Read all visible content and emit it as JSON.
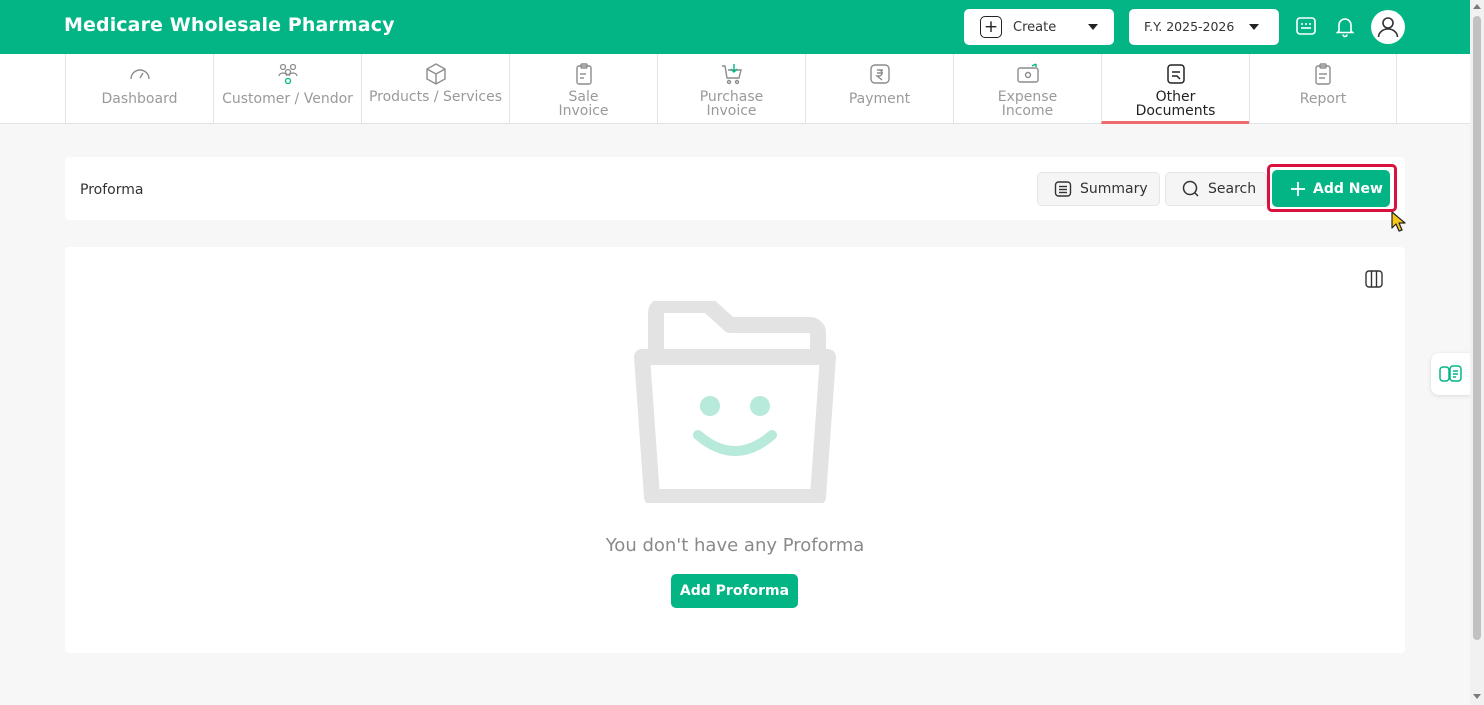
{
  "header": {
    "app_title": "Medicare Wholesale Pharmacy",
    "create_label": "Create",
    "fy_label": "F.Y. 2025-2026",
    "brand_color": "#03b585"
  },
  "nav": {
    "items": [
      {
        "label": "Dashboard",
        "icon": "gauge-icon"
      },
      {
        "label": "Customer / Vendor",
        "icon": "users-icon"
      },
      {
        "label": "Products / Services",
        "icon": "box-icon"
      },
      {
        "label": "Sale\nInvoice",
        "icon": "clipboard-icon"
      },
      {
        "label": "Purchase\nInvoice",
        "icon": "cart-icon"
      },
      {
        "label": "Payment",
        "icon": "rupee-icon"
      },
      {
        "label": "Expense\nIncome",
        "icon": "money-icon"
      },
      {
        "label": "Other\nDocuments",
        "icon": "document-icon",
        "active": true
      },
      {
        "label": "Report",
        "icon": "report-icon"
      }
    ],
    "active_underline_color": "#ef6b6b"
  },
  "page": {
    "title": "Proforma",
    "summary_label": "Summary",
    "search_label": "Search",
    "add_new_label": "Add New",
    "highlight_color": "#d9113f"
  },
  "empty_state": {
    "message": "You don't have any Proforma",
    "button_label": "Add Proforma"
  }
}
